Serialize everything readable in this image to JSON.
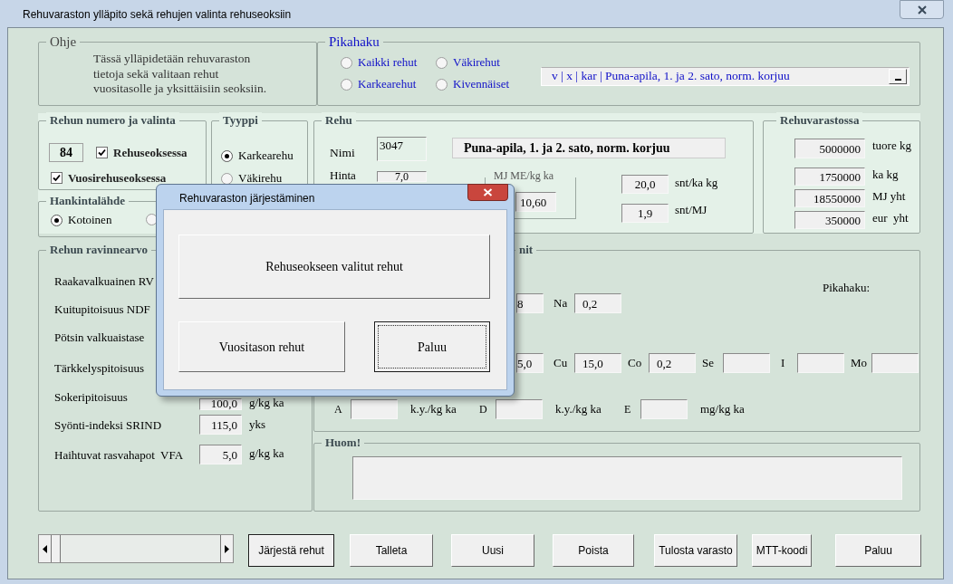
{
  "window": {
    "title": "Rehuvaraston ylläpito sekä rehujen valinta rehuseoksiin"
  },
  "help": {
    "title": "Ohje",
    "lines": [
      "Tässä ylläpidetään rehuvaraston",
      "tietoja sekä valitaan rehut",
      "vuositasolle ja yksittäisiin seoksiin."
    ]
  },
  "quick_search": {
    "title": "Pikahaku",
    "options": [
      {
        "label": "Kaikki rehut",
        "selected": false
      },
      {
        "label": "Karkearehut",
        "selected": false
      },
      {
        "label": "Väkirehut",
        "selected": false
      },
      {
        "label": "Kivennäiset",
        "selected": false
      }
    ],
    "combo_value": "v | x | kar | Puna-apila, 1. ja 2. sato, norm. korjuu"
  },
  "feed_selection": {
    "title": "Rehun numero ja valinta",
    "number": "84",
    "checkboxes": [
      {
        "label": "Rehuseoksessa",
        "checked": true
      },
      {
        "label": "Vuosirehuseoksessa",
        "checked": true
      }
    ]
  },
  "type": {
    "title": "Tyyppi",
    "options": [
      {
        "label": "Karkearehu",
        "selected": true
      },
      {
        "label": "Väkirehu",
        "selected": false
      }
    ]
  },
  "source": {
    "title": "Hankintalähde",
    "options": [
      {
        "label": "Kotoinen",
        "selected": true
      },
      {
        "selected": false
      }
    ]
  },
  "feed": {
    "title": "Rehu",
    "name_label": "Nimi",
    "code": "3047",
    "name": "Puna-apila, 1. ja 2. sato, norm. korjuu",
    "price_label": "Hinta",
    "price": "7,0",
    "energy_title": "MJ ME/kg ka",
    "energy": "10,60",
    "costs": [
      {
        "value": "20,0",
        "unit": "snt/ka kg"
      },
      {
        "value": "1,9",
        "unit": "snt/MJ"
      }
    ]
  },
  "stock": {
    "title": "Rehuvarastossa",
    "rows": [
      {
        "value": "5000000",
        "unit": "tuore kg"
      },
      {
        "value": "1750000",
        "unit": "ka kg"
      },
      {
        "value": "18550000",
        "unit": "MJ yht"
      },
      {
        "value": "350000",
        "unit": "eur  yht"
      }
    ]
  },
  "nutrients": {
    "title": "Rehun ravinnearvo",
    "rows": [
      {
        "label": "Raakavalkuainen RV"
      },
      {
        "label": "Kuitupitoisuus NDF"
      },
      {
        "label": "Pötsin valkuaistase"
      },
      {
        "label": "Tärkkelyspitoisuus"
      },
      {
        "label": "Sokeripitoisuus",
        "value": "100,0",
        "unit": "g/kg ka"
      },
      {
        "label": "Syönti-indeksi SRIND",
        "value": "115,0",
        "unit": "yks"
      },
      {
        "label": "Haihtuvat rasvahapot  VFA",
        "value": "5,0",
        "unit": "g/kg ka"
      }
    ]
  },
  "minerals": {
    "title": "nit",
    "search_label": "Pikahaku:",
    "row_1": [
      {
        "value": "8"
      },
      {
        "label": "Na",
        "value": "0,2"
      }
    ],
    "row_2": [
      {
        "value": "5,0"
      },
      {
        "label": "Cu",
        "value": "15,0"
      },
      {
        "label": "Co",
        "value": "0,2"
      },
      {
        "label": "Se"
      },
      {
        "label": "I"
      },
      {
        "label": "Mo"
      }
    ],
    "vitamins": [
      {
        "label": "A",
        "unit": "k.y./kg ka"
      },
      {
        "label": "D",
        "unit": "k.y./kg ka"
      },
      {
        "label": "E",
        "unit": "mg/kg ka"
      }
    ]
  },
  "notes": {
    "title": "Huom!"
  },
  "buttons": [
    {
      "label": "Järjestä rehut",
      "focused": true
    },
    {
      "label": "Talleta",
      "focused": false
    },
    {
      "label": "Uusi",
      "focused": false
    },
    {
      "label": "Poista",
      "focused": false
    },
    {
      "label": "Tulosta varasto",
      "focused": false
    },
    {
      "label": "MTT-koodi",
      "focused": false
    },
    {
      "label": "Paluu",
      "focused": false
    }
  ],
  "dialog": {
    "title": "Rehuvaraston järjestäminen",
    "buttons": [
      {
        "label": "Rehuseokseen valitut rehut",
        "focused": false
      },
      {
        "label": "Vuositason rehut",
        "focused": false
      },
      {
        "label": "Paluu",
        "focused": true
      }
    ]
  }
}
